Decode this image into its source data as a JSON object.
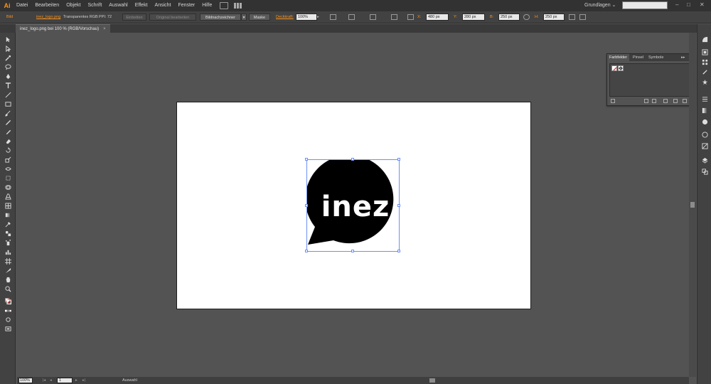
{
  "app": {
    "logo": "Ai"
  },
  "menu": [
    "Datei",
    "Bearbeiten",
    "Objekt",
    "Schrift",
    "Auswahl",
    "Effekt",
    "Ansicht",
    "Fenster",
    "Hilfe"
  ],
  "workspace": {
    "label": "Grundlagen",
    "chevron": "⌄"
  },
  "window_controls": {
    "minimize": "–",
    "maximize": "□",
    "close": "✕"
  },
  "control_bar": {
    "object_type": "Bild",
    "file_link": "inez_logo.png",
    "color_mode": "Transparentes RGB",
    "ppi": "PPI: 72",
    "embed_button": "Einbetten",
    "edit_original_button": "Original bearbeiten",
    "image_trace_button": "Bildnachzeichner",
    "mask_button": "Maske",
    "opacity_label": "Deckkraft:",
    "opacity_value": "100%",
    "x_label": "X:",
    "x_value": "480 px",
    "y_label": "Y:",
    "y_value": "280 px",
    "w_label": "B:",
    "w_value": "250 px",
    "h_label": "H:",
    "h_value": "250 px"
  },
  "document_tab": {
    "title": "inez_logo.png bei 100 % (RGB/Vorschau)",
    "close": "×"
  },
  "logo": {
    "text": "inez",
    "bubble_color": "#000000",
    "text_color": "#ffffff"
  },
  "swatch_panel": {
    "tabs": [
      "Farbfelder",
      "Pinsel",
      "Symbole"
    ],
    "active_tab": "Farbfelder",
    "menu_icon": "≡",
    "collapse_icon": "▸▸"
  },
  "status_bar": {
    "zoom": "100%",
    "page": "1",
    "tool": "Auswahl"
  },
  "colors": {
    "accent": "#f7931e",
    "selection": "#6d8ff5"
  }
}
